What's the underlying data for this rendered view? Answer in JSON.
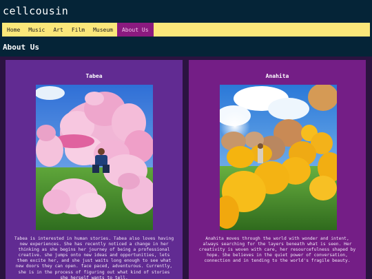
{
  "site": {
    "title": "cellcousin"
  },
  "nav": {
    "items": [
      {
        "label": "Home"
      },
      {
        "label": "Music"
      },
      {
        "label": "Art"
      },
      {
        "label": "Film"
      },
      {
        "label": "Museum"
      },
      {
        "label": "About Us",
        "active": true
      }
    ]
  },
  "page": {
    "heading": "About Us"
  },
  "people": [
    {
      "name": "Tabea",
      "bio": "Tabea is interested in human stories. Tabea also loves having new experiences. She has recently noticed a change in her thinking as she begins her journey of being a professional creative. she jumps onto new ideas and opportunities, lets them excite her, and she just waits long enough to see what new doors they can open. face paced, adventurous. Currently, she is in the process of figuring out what kind of stories she herself wants to tell."
    },
    {
      "name": "Anahita",
      "bio": "Anahita moves through the world with wonder and intent, always searching for the layers beneath what is seen. Her creativity is woven with care, her resourcefulness shaped by hope. She believes in the quiet power of conversation, connection and in tending to the world's fragile beauty."
    }
  ],
  "colors": {
    "background": "#052437",
    "navbar": "#fbe77a",
    "nav_active": "#8b1a7f",
    "card_left": "#612b92",
    "card_right": "#741e86"
  }
}
